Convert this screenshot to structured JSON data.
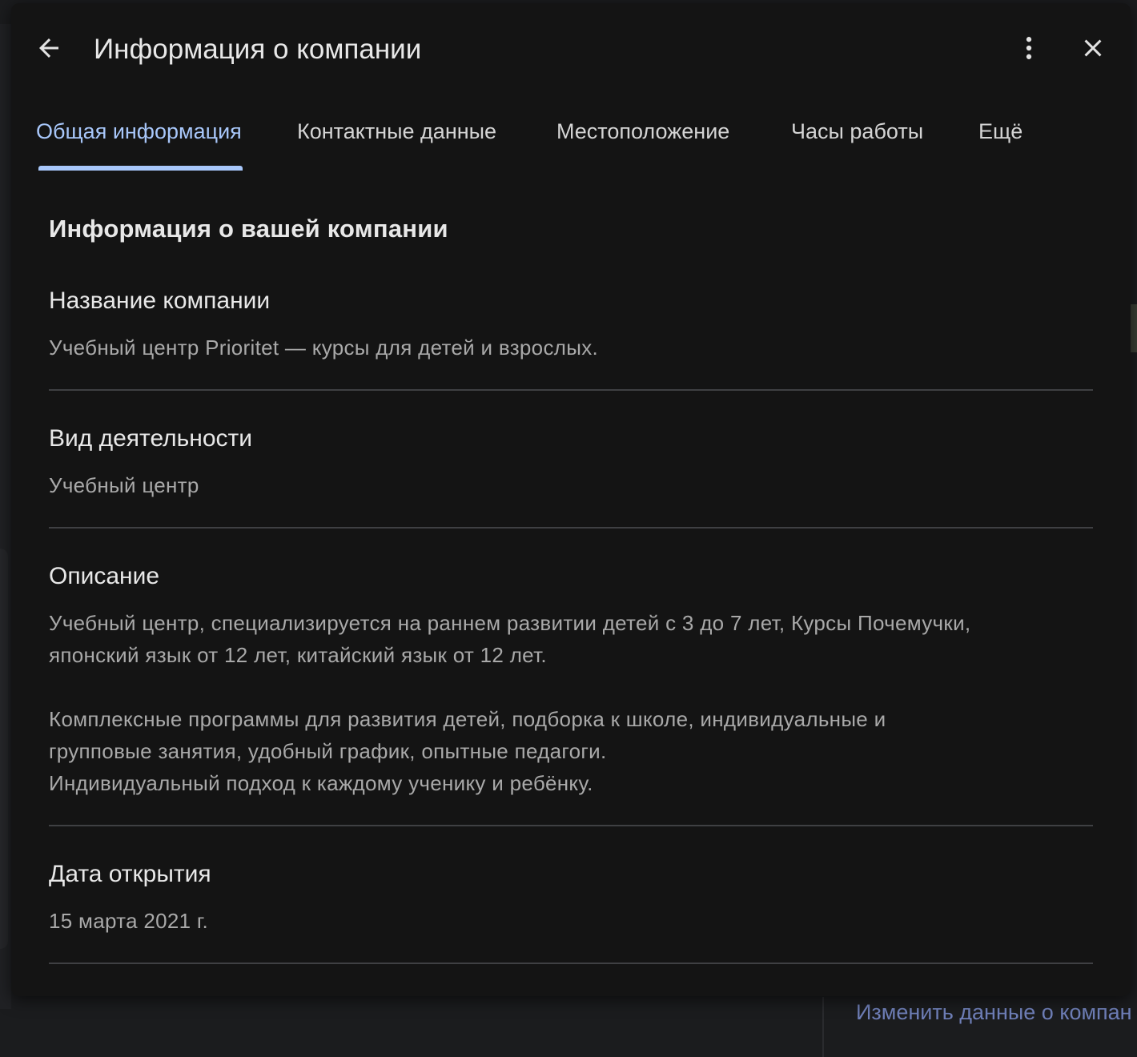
{
  "dialog": {
    "title": "Информация о компании"
  },
  "tabs": [
    {
      "label": "Общая информация",
      "active": true
    },
    {
      "label": "Контактные данные",
      "active": false
    },
    {
      "label": "Местоположение",
      "active": false
    },
    {
      "label": "Часы работы",
      "active": false
    },
    {
      "label": "Ещё",
      "active": false
    }
  ],
  "section": {
    "heading": "Информация о вашей компании"
  },
  "fields": {
    "name": {
      "label": "Название компании",
      "value": "Учебный центр Prioritet — курсы для детей и взрослых."
    },
    "category": {
      "label": "Вид деятельности",
      "value": "Учебный центр"
    },
    "description": {
      "label": "Описание",
      "line1": "Учебный центр, специализируется на раннем развитии детей с 3 до 7 лет, Курсы Почемучки,",
      "line2": "японский язык от 12 лет, китайский язык от 12 лет.",
      "line3": "Комплексные программы для развития детей, подборка к школе, индивидуальные и",
      "line4": "групповые занятия, удобный график, опытные педагоги.",
      "line5": "Индивидуальный подход к каждому ученику и ребёнку."
    },
    "opening_date": {
      "label": "Дата открытия",
      "value": "15 марта 2021 г."
    }
  },
  "background": {
    "edit_link": "Изменить данные о компан"
  },
  "colors": {
    "accent": "#a8c7fa",
    "dialog_bg": "#141414",
    "divider": "#3f4043"
  }
}
